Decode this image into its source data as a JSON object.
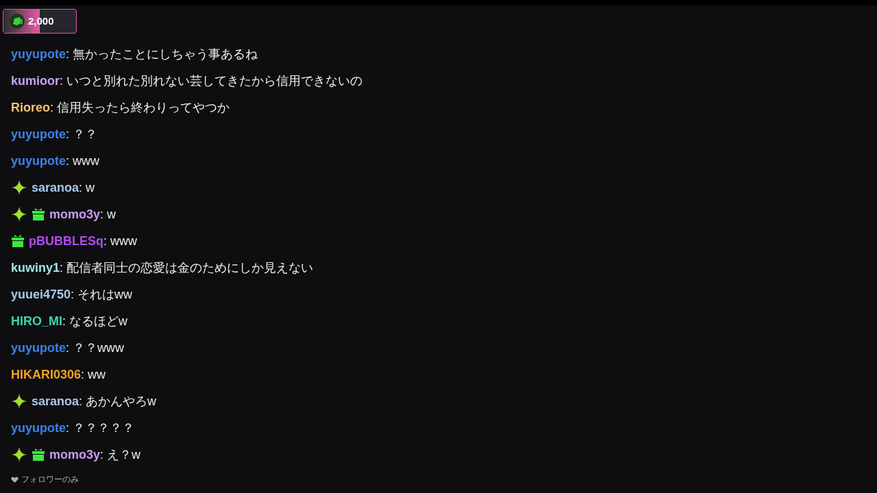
{
  "points_badge": {
    "amount": "2,000",
    "level": 0.5
  },
  "messages": [
    {
      "user": "yuyupote",
      "color": "#3b82e8",
      "text": ": 無かったことにしちゃう事あるね"
    },
    {
      "user": "kumioor",
      "color": "#c7a1f4",
      "text": ": いつと別れた別れない芸してきたから信用できないの"
    },
    {
      "user": "Rioreo",
      "color": "#f4c46c",
      "text": ": 信用失ったら終わりってやつか"
    },
    {
      "user": "yuyupote",
      "color": "#3b82e8",
      "text": ": ？？"
    },
    {
      "user": "yuyupote",
      "color": "#3b82e8",
      "text": ": www"
    },
    {
      "user": "saranoa",
      "color": "#a9c6ec",
      "badges": [
        {
          "kind": "sparkle"
        }
      ],
      "text": ": w"
    },
    {
      "user": "momo3y",
      "color": "#c99cf0",
      "badges": [
        {
          "kind": "sparkle"
        },
        {
          "kind": "gift"
        }
      ],
      "text": ": w"
    },
    {
      "user": "pBUBBLESq",
      "color": "#b24cf0",
      "badges": [
        {
          "kind": "gift"
        }
      ],
      "text": ": www"
    },
    {
      "user": "kuwiny1",
      "color": "#a4e6e6",
      "text": ": 配信者同士の恋愛は金のためにしか見えない"
    },
    {
      "user": "yuuei4750",
      "color": "#a9c6ec",
      "text": ": それはww"
    },
    {
      "user": "HIRO_MI",
      "color": "#3ed6ae",
      "text": ": なるほどw"
    },
    {
      "user": "yuyupote",
      "color": "#3b82e8",
      "text": ": ？？www"
    },
    {
      "user": "HIKARI0306",
      "color": "#f0a020",
      "text": ": ww"
    },
    {
      "user": "saranoa",
      "color": "#a9c6ec",
      "badges": [
        {
          "kind": "sparkle"
        }
      ],
      "text": ": あかんやろw"
    },
    {
      "user": "yuyupote",
      "color": "#3b82e8",
      "text": ": ？？？？？"
    },
    {
      "user": "momo3y",
      "color": "#c99cf0",
      "badges": [
        {
          "kind": "sparkle"
        },
        {
          "kind": "gift"
        }
      ],
      "text": ": え？w"
    }
  ],
  "chat_mode": "フォロワーのみ"
}
